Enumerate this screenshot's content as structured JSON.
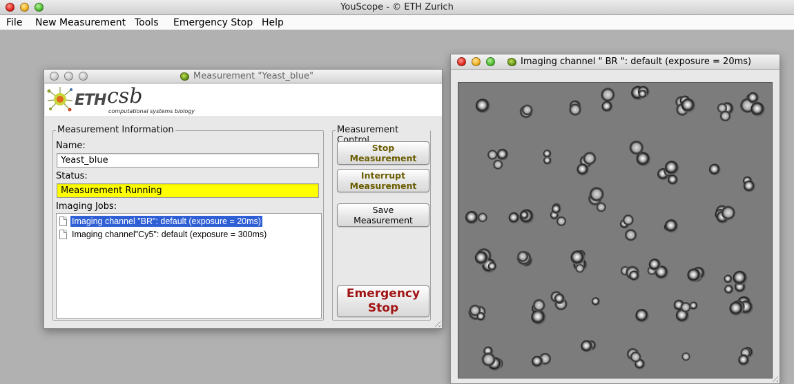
{
  "app": {
    "title": "YouScope - © ETH Zurich"
  },
  "menubar": {
    "items": [
      "File",
      "New Measurement",
      "Tools",
      "Emergency Stop",
      "Help"
    ]
  },
  "measurement_window": {
    "title": "Measurement \"Yeast_blue\"",
    "logo": {
      "eth": "ETH",
      "csb": "csb",
      "subtitle": "computational systems biology"
    },
    "info": {
      "group_title": "Measurement Information",
      "name_label": "Name:",
      "name_value": "Yeast_blue",
      "status_label": "Status:",
      "status_value": "Measurement Running",
      "status_color": "#ffff00",
      "jobs_label": "Imaging Jobs:",
      "jobs": [
        {
          "label": "Imaging channel \"BR\": default (exposure = 20ms)",
          "selected": true
        },
        {
          "label": "Imaging channel\"Cy5\": default (exposure = 300ms)",
          "selected": false
        }
      ]
    },
    "control": {
      "group_title": "Measurement Control",
      "stop": [
        "Stop",
        "Measurement"
      ],
      "interrupt": [
        "Interrupt",
        "Measurement"
      ],
      "save": [
        "Save",
        "Measurement"
      ],
      "emergency": [
        "Emergency",
        "Stop"
      ],
      "emergency_color": "#a11414"
    }
  },
  "image_window": {
    "title": "Imaging channel \" BR  \": default (exposure = 20ms)",
    "image_description": "grayscale brightfield microscopy of yeast cells"
  }
}
